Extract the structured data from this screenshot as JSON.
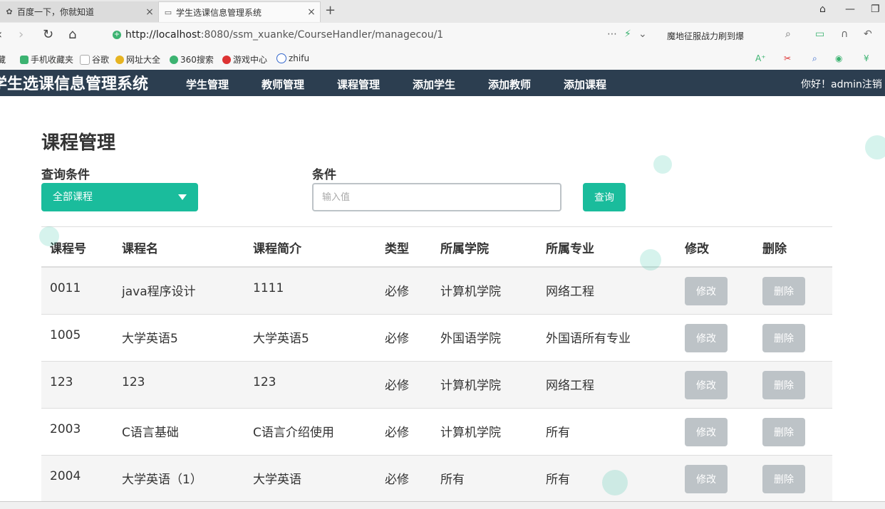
{
  "browser": {
    "tabs": [
      {
        "label": "百度一下，你就知道",
        "active": false
      },
      {
        "label": "学生选课信息管理系统",
        "active": true
      }
    ],
    "url_host": "http://localhost",
    "url_rest": ":8080/ssm_xuanke/CourseHandler/managecou/1",
    "search_text": "魔地征服战力刷到爆",
    "bookmarks": [
      "手机收藏夹",
      "谷歌",
      "网址大全",
      "360搜索",
      "游戏中心",
      "zhifu"
    ],
    "bookmark_prefix": "藏"
  },
  "app": {
    "brand": "学生选课信息管理系统",
    "nav": [
      "学生管理",
      "教师管理",
      "课程管理",
      "添加学生",
      "添加教师",
      "添加课程"
    ],
    "greeting": "你好！admin注销"
  },
  "page": {
    "title": "课程管理",
    "filter_label": "查询条件",
    "condition_label": "条件",
    "select_value": "全部课程",
    "input_placeholder": "输入值",
    "query_button": "查询"
  },
  "table": {
    "headers": [
      "课程号",
      "课程名",
      "课程简介",
      "类型",
      "所属学院",
      "所属专业",
      "修改",
      "删除"
    ],
    "rows": [
      {
        "id": "0011",
        "name": "java程序设计",
        "desc": "1111",
        "type": "必修",
        "college": "计算机学院",
        "major": "网络工程",
        "edit": "修改",
        "del": "删除"
      },
      {
        "id": "1005",
        "name": "大学英语5",
        "desc": "大学英语5",
        "type": "必修",
        "college": "外国语学院",
        "major": "外国语所有专业",
        "edit": "修改",
        "del": "删除"
      },
      {
        "id": "123",
        "name": "123",
        "desc": "123",
        "type": "必修",
        "college": "计算机学院",
        "major": "网络工程",
        "edit": "修改",
        "del": "删除"
      },
      {
        "id": "2003",
        "name": "C语言基础",
        "desc": "C语言介绍使用",
        "type": "必修",
        "college": "计算机学院",
        "major": "所有",
        "edit": "修改",
        "del": "删除"
      },
      {
        "id": "2004",
        "name": "大学英语（1）",
        "desc": "大学英语",
        "type": "必修",
        "college": "所有",
        "major": "所有",
        "edit": "修改",
        "del": "删除"
      }
    ]
  },
  "colors": {
    "accent": "#1abc9c",
    "navbar": "#2c3e50",
    "disabled_button": "#bdc3c7"
  }
}
